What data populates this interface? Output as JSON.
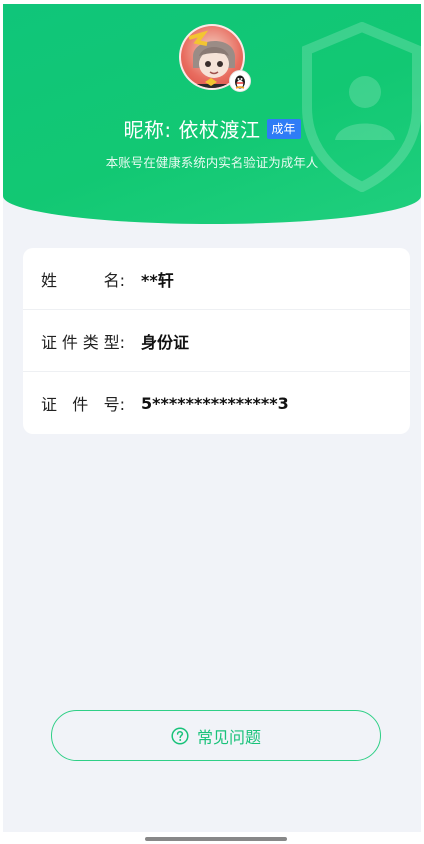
{
  "profile": {
    "nickname": "昵称: 依杖渡江",
    "badge": "成年",
    "verify_note": "本账号在健康系统内实名验证为成年人"
  },
  "info": {
    "rows": [
      {
        "label_chars": [
          "姓",
          "名:"
        ],
        "value": "**轩"
      },
      {
        "label_chars": [
          "证",
          "件",
          "类",
          "型:"
        ],
        "value": "身份证"
      },
      {
        "label_chars": [
          "证",
          "件",
          "号:"
        ],
        "value": "5***************3"
      }
    ]
  },
  "faq": {
    "label": "常见问题"
  },
  "colors": {
    "header_green": "#12c873",
    "badge_blue": "#2f7cf6",
    "accent_green": "#19c27a",
    "page_bg": "#f1f3f8"
  },
  "icons": {
    "shield": "shield-user-icon",
    "help": "question-circle-icon",
    "qq": "qq-penguin-icon"
  }
}
